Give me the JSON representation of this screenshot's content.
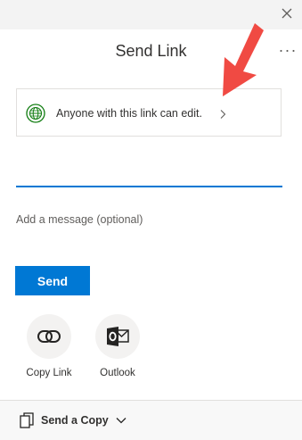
{
  "dialog": {
    "title": "Send Link",
    "more_label": "···"
  },
  "permission": {
    "text": "Anyone with this link can edit.",
    "icon": "globe-icon"
  },
  "recipient": {
    "value": "",
    "placeholder": ""
  },
  "message": {
    "value": "",
    "placeholder": "Add a message (optional)"
  },
  "send_button": {
    "label": "Send"
  },
  "share_options": [
    {
      "label": "Copy Link",
      "icon": "link-icon"
    },
    {
      "label": "Outlook",
      "icon": "outlook-icon"
    }
  ],
  "footer": {
    "send_copy_label": "Send a Copy"
  },
  "colors": {
    "accent": "#0078d4",
    "globe_green": "#107c10",
    "annotation_red": "#f04a43"
  }
}
